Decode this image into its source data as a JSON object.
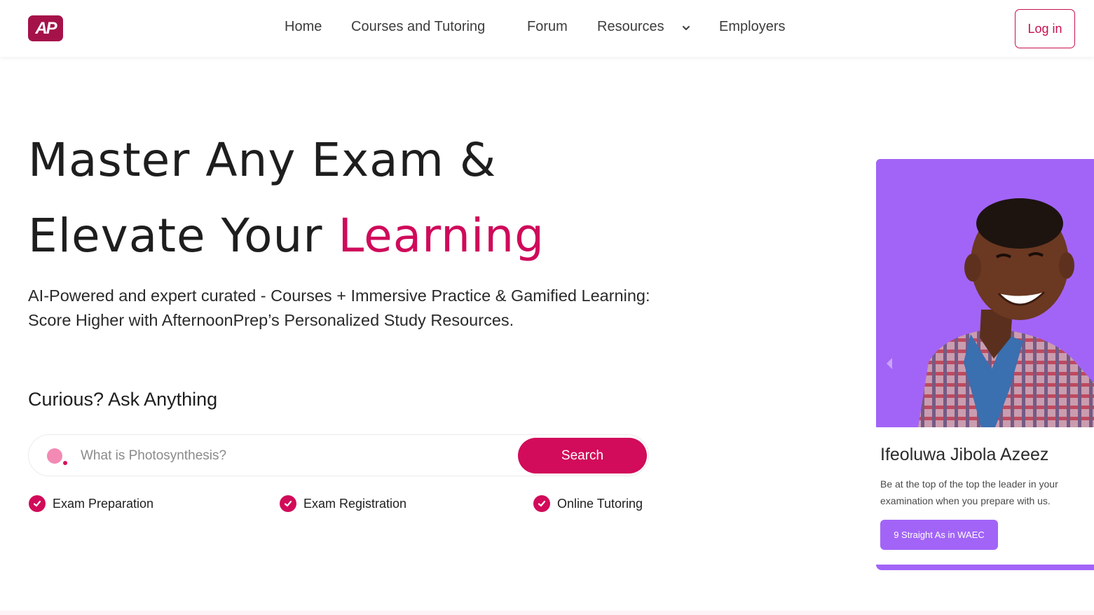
{
  "header": {
    "logo_text": "AP",
    "nav": {
      "home": "Home",
      "courses": "Courses and Tutoring",
      "forum": "Forum",
      "resources": "Resources",
      "employers": "Employers"
    },
    "login_label": "Log in"
  },
  "hero": {
    "title_line1": "Master Any Exam &",
    "title_line2_plain": "Elevate Your ",
    "title_line2_accent": "Learning",
    "subtitle": "AI-Powered and expert curated - Courses + Immersive Practice & Gamified Learning: Score Higher with AfternoonPrep’s Personalized Study Resources."
  },
  "ask": {
    "heading": "Curious? Ask Anything",
    "placeholder": "What is Photosynthesis?",
    "search_label": "Search"
  },
  "features": [
    {
      "label": "Exam Preparation"
    },
    {
      "label": "Exam Registration"
    },
    {
      "label": "Online Tutoring"
    }
  ],
  "card": {
    "name": "Ifeoluwa Jibola Azeez",
    "description": "Be at the top of the top the leader in your examination when you prepare with us.",
    "badge": "9 Straight As in WAEC"
  },
  "colors": {
    "accent": "#cf0a5a",
    "logo": "#a5124a",
    "card_purple": "#a264f7"
  },
  "icons": [
    "chevron-down-icon",
    "check-icon",
    "chevron-left-icon",
    "person-photo"
  ]
}
